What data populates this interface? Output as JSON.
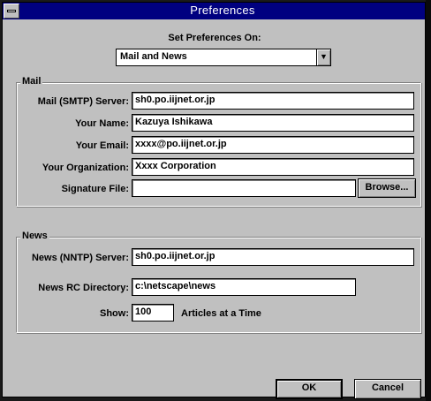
{
  "window": {
    "title": "Preferences"
  },
  "header": {
    "set_on_label": "Set Preferences On:",
    "category_value": "Mail and News"
  },
  "mail": {
    "group_label": "Mail",
    "smtp_label": "Mail (SMTP) Server:",
    "smtp_value": "sh0.po.iijnet.or.jp",
    "name_label": "Your Name:",
    "name_value": "Kazuya Ishikawa",
    "email_label": "Your Email:",
    "email_value": "xxxx@po.iijnet.or.jp",
    "org_label": "Your Organization:",
    "org_value": "Xxxx Corporation",
    "sig_label": "Signature File:",
    "sig_value": "",
    "browse_label": "Browse..."
  },
  "news": {
    "group_label": "News",
    "nntp_label": "News (NNTP) Server:",
    "nntp_value": "sh0.po.iijnet.or.jp",
    "rc_label": "News RC Directory:",
    "rc_value": "c:\\netscape\\news",
    "show_label": "Show:",
    "show_value": "100",
    "show_suffix": "Articles at a Time"
  },
  "buttons": {
    "ok": "OK",
    "cancel": "Cancel"
  }
}
